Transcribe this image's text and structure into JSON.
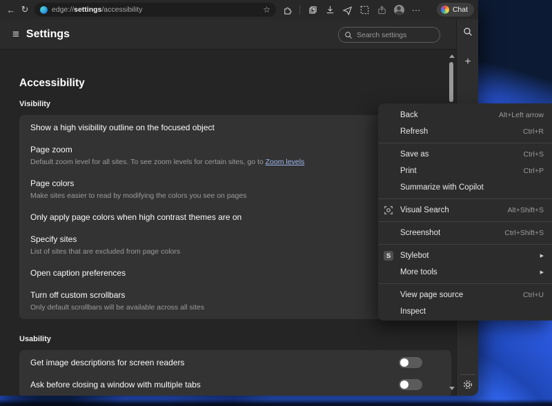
{
  "colors": {
    "page_bg": "#252525",
    "card_bg": "#333333",
    "toolbar_bg": "#282828",
    "menu_bg": "#2c2c2c",
    "link_blue": "#9eb8f0",
    "wallpaper_blue": "#2c5ce4"
  },
  "toolbar": {
    "url_prefix": "edge://",
    "url_bold": "settings",
    "url_suffix": "/accessibility",
    "star_glyph": "☆",
    "back_glyph": "←",
    "refresh_glyph": "↻",
    "more_glyph": "···",
    "chat_label": "Chat"
  },
  "header": {
    "menu_glyph": "≡",
    "title": "Settings",
    "search_placeholder": "Search settings"
  },
  "rail": {
    "plus_glyph": "+"
  },
  "page": {
    "title": "Accessibility",
    "visibility": {
      "heading": "Visibility",
      "rows": [
        {
          "title": "Show a high visibility outline on the focused object"
        },
        {
          "title": "Page zoom",
          "subtitle": "Default zoom level for all sites. To see zoom levels for certain sites, go to ",
          "link": "Zoom levels"
        },
        {
          "title": "Page colors",
          "subtitle": "Make sites easier to read by modifying the colors you see on pages"
        },
        {
          "title": "Only apply page colors when high contrast themes are on"
        },
        {
          "title": "Specify sites",
          "subtitle": "List of sites that are excluded from page colors"
        },
        {
          "title": "Open caption preferences"
        },
        {
          "title": "Turn off custom scrollbars",
          "subtitle": "Only default scrollbars will be available across all sites"
        }
      ]
    },
    "usability": {
      "heading": "Usability",
      "rows": [
        {
          "title": "Get image descriptions for screen readers",
          "toggle": "off"
        },
        {
          "title": "Ask before closing a window with multiple tabs",
          "toggle": "off"
        }
      ]
    }
  },
  "context_menu": {
    "stylebot_badge": "S",
    "submenu_arrow": "▶",
    "items": [
      {
        "label": "Back",
        "shortcut": "Alt+Left arrow"
      },
      {
        "label": "Refresh",
        "shortcut": "Ctrl+R"
      },
      {
        "label": "Save as",
        "shortcut": "Ctrl+S"
      },
      {
        "label": "Print",
        "shortcut": "Ctrl+P"
      },
      {
        "label": "Summarize with Copilot",
        "shortcut": ""
      },
      {
        "label": "Visual Search",
        "shortcut": "Alt+Shift+S"
      },
      {
        "label": "Screenshot",
        "shortcut": "Ctrl+Shift+S"
      },
      {
        "label": "Stylebot",
        "shortcut": ""
      },
      {
        "label": "More tools",
        "shortcut": ""
      },
      {
        "label": "View page source",
        "shortcut": "Ctrl+U"
      },
      {
        "label": "Inspect",
        "shortcut": ""
      }
    ]
  }
}
